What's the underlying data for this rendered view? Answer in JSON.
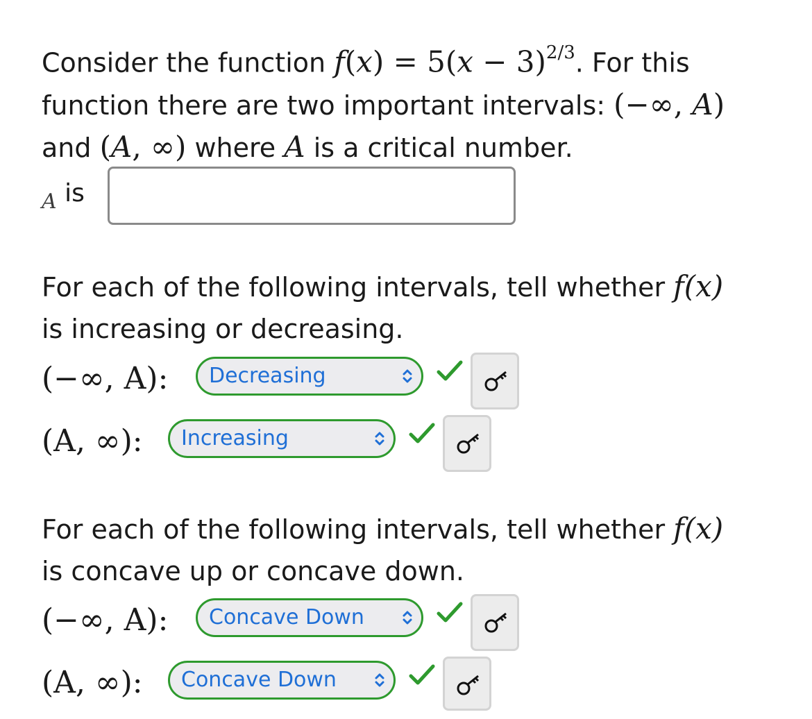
{
  "intro": {
    "text_consider": "Consider the function ",
    "f_lhs": "f",
    "x_var": "x",
    "equals": "= 5(",
    "minus_three": " − 3)",
    "exponent": "2/3",
    "text_for_this": ". For this",
    "text_line2": "function there are two important intervals: ",
    "interval_neg": "(−∞, ",
    "A_var": "A",
    "close_paren": ")",
    "text_and": "and ",
    "interval_pos_open": "(",
    "interval_pos_rest": ", ∞)",
    "text_where": " where ",
    "text_critical": " is a critical number."
  },
  "critical_answer": {
    "label_glyph": "A",
    "label_is": " is",
    "value": "",
    "placeholder": ""
  },
  "section_increasing": {
    "text_line1": "For each of the following intervals, tell whether ",
    "fx": "f(x)",
    "text_line2": "is increasing or decreasing.",
    "rows": [
      {
        "interval": "(−∞, A):",
        "selected": "Decreasing",
        "status": "correct"
      },
      {
        "interval": "(A, ∞):",
        "selected": "Increasing",
        "status": "correct"
      }
    ]
  },
  "section_concavity": {
    "text_line1": "For each of the following intervals, tell whether ",
    "fx": "f(x)",
    "text_line2": "is concave up or concave down.",
    "rows": [
      {
        "interval": "(−∞, A):",
        "selected": "Concave Down",
        "status": "correct"
      },
      {
        "interval": "(A, ∞):",
        "selected": "Concave Down",
        "status": "correct"
      }
    ]
  },
  "colors": {
    "accent_blue": "#1f6fd6",
    "correct_green": "#2e9a2e"
  },
  "icons": {
    "check": "checkmark-icon",
    "key": "key-icon",
    "select": "chevron-updown-icon"
  }
}
